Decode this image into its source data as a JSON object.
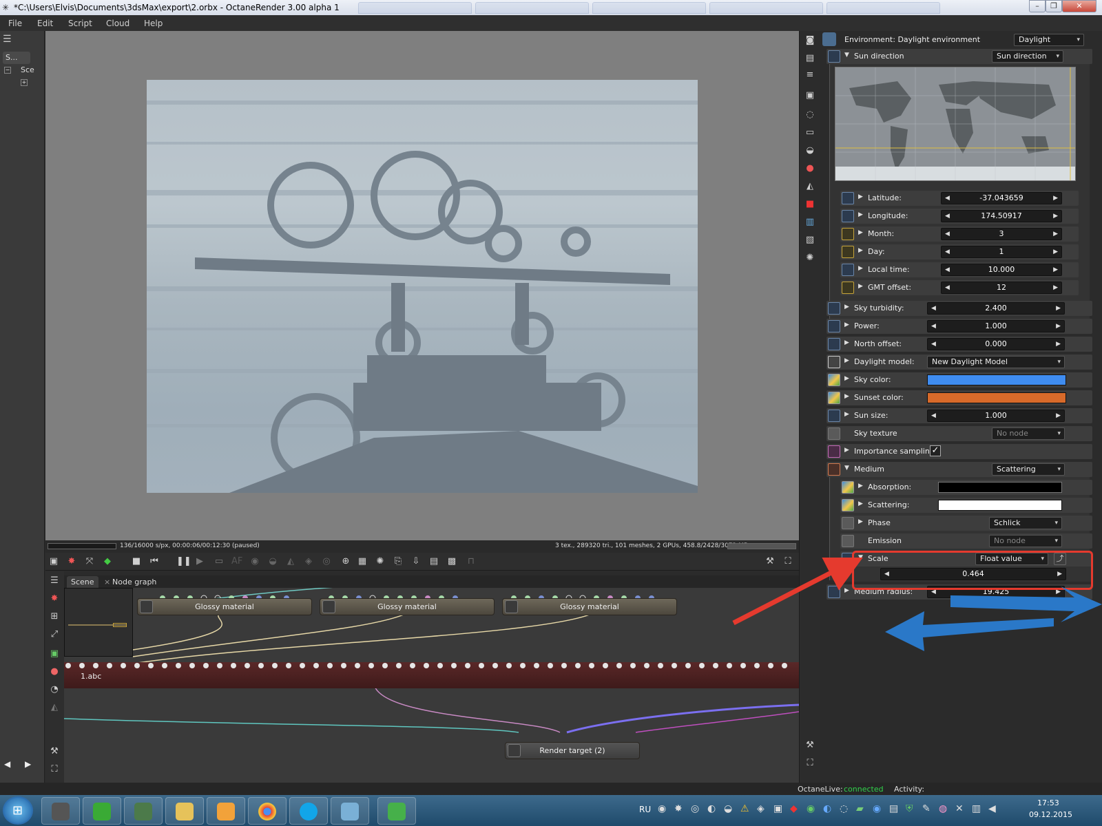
{
  "window": {
    "title": "*C:\\Users\\Elvis\\Documents\\3dsMax\\export\\2.orbx - OctaneRender 3.00 alpha 1",
    "controls": [
      "minimize",
      "restore",
      "close"
    ]
  },
  "menu": [
    "File",
    "Edit",
    "Script",
    "Cloud",
    "Help"
  ],
  "left_panel": {
    "tab_label": "S...",
    "tree_item": "Sce"
  },
  "status": {
    "left": "136/16000 s/px, 00:00:06/00:12:30 (paused)",
    "right": "3 tex., 289320 tri., 101 meshes, 2 GPUs, 458.8/2428/3072 MB"
  },
  "graph": {
    "tabs": [
      "Scene",
      "Node graph"
    ],
    "tab_close": "×",
    "nodes": [
      "Glossy material",
      "Glossy material",
      "Glossy material"
    ],
    "mesh_label": "1.abc",
    "render_target": "Render target (2)"
  },
  "props": {
    "header": {
      "label": "Environment: Daylight environment",
      "value": "Daylight"
    },
    "sun_direction": {
      "label": "Sun direction",
      "value": "Sun direction"
    },
    "latitude": {
      "label": "Latitude:",
      "value": "-37.043659"
    },
    "longitude": {
      "label": "Longitude:",
      "value": "174.50917"
    },
    "month": {
      "label": "Month:",
      "value": "3"
    },
    "day": {
      "label": "Day:",
      "value": "1"
    },
    "local_time": {
      "label": "Local time:",
      "value": "10.000"
    },
    "gmt_offset": {
      "label": "GMT offset:",
      "value": "12"
    },
    "sky_turbidity": {
      "label": "Sky turbidity:",
      "value": "2.400"
    },
    "power": {
      "label": "Power:",
      "value": "1.000"
    },
    "north_offset": {
      "label": "North offset:",
      "value": "0.000"
    },
    "daylight_model": {
      "label": "Daylight model:",
      "value": "New Daylight Model"
    },
    "sky_color": {
      "label": "Sky color:",
      "color": "#3f8cf0"
    },
    "sunset_color": {
      "label": "Sunset color:",
      "color": "#d86a2a"
    },
    "sun_size": {
      "label": "Sun size:",
      "value": "1.000"
    },
    "sky_texture": {
      "label": "Sky texture",
      "value": "No node"
    },
    "importance_sampling": {
      "label": "Importance sampling:",
      "checked": "✓"
    },
    "medium": {
      "label": "Medium",
      "value": "Scattering"
    },
    "absorption": {
      "label": "Absorption:",
      "color": "#000000"
    },
    "scattering": {
      "label": "Scattering:",
      "color": "#ffffff"
    },
    "phase": {
      "label": "Phase",
      "value": "Schlick"
    },
    "emission": {
      "label": "Emission",
      "value": "No node"
    },
    "scale": {
      "label": "Scale",
      "value": "Float value",
      "slider": "0.464"
    },
    "medium_radius": {
      "label": "Medium radius:",
      "value": "19.425"
    }
  },
  "livebar": {
    "label": "OctaneLive:",
    "state": "connected",
    "activity": "Activity:"
  },
  "taskbar": {
    "lang": "RU",
    "time": "17:53",
    "date": "09.12.2015"
  },
  "colors": {
    "accent_red": "#e53a2e",
    "accent_blue": "#2a78c8",
    "connected": "#31d14b"
  }
}
